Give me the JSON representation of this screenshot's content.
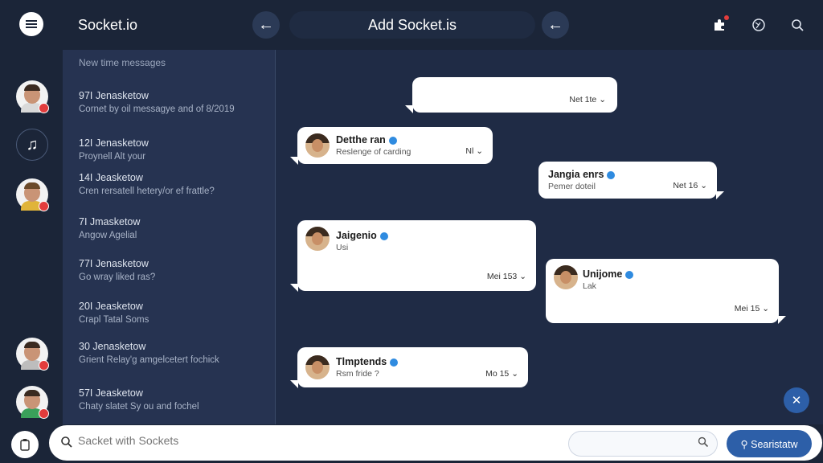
{
  "app": {
    "title": "Socket.io"
  },
  "header": {
    "title": "Add Socket.is",
    "back_arrow_left": "←",
    "back_arrow_right": "←"
  },
  "list": {
    "header": "New time messages",
    "items": [
      {
        "name": "97I Jenasketow",
        "msg": "Cornet by oil messagye and of 8/2019"
      },
      {
        "name": "12I Jenasketow",
        "msg": "Proynell Alt your"
      },
      {
        "name": "14I Jeasketow",
        "msg": "Cren rersatell hetery/or ef frattle?"
      },
      {
        "name": "7I Jmasketow",
        "msg": "Angow Agelial"
      },
      {
        "name": "77I Jenasketow",
        "msg": "Go wray liked ras?"
      },
      {
        "name": "20I Jeasketow",
        "msg": "Crapl Tatal Soms"
      },
      {
        "name": "30 Jenasketow",
        "msg": "Grient Relay'g amgelcetert fochick"
      },
      {
        "name": "57I Jeasketow",
        "msg": "Chaty slatet Sy ou and fochel"
      }
    ]
  },
  "chat": {
    "bubbles": [
      {
        "name": "",
        "sub": "",
        "time": "Net 1te ⌄"
      },
      {
        "name": "Detthe ran",
        "sub": "Reslenge of carding",
        "time": "Nl ⌄"
      },
      {
        "name": "Jangia enrs",
        "sub": "Pemer doteil",
        "time": "Net 16 ⌄"
      },
      {
        "name": "Jaigenio",
        "sub": "Usi",
        "time": "Mei 153 ⌄"
      },
      {
        "name": "Unijome",
        "sub": "Lak",
        "time": "Mei 15 ⌄"
      },
      {
        "name": "Tlmptends",
        "sub": "Rsm fride ?",
        "time": "Mo 15 ⌄"
      }
    ]
  },
  "bottom": {
    "input_placeholder": "Sacket with Sockets",
    "mini_search_placeholder": "",
    "send_label": "⚲ Searistatw"
  },
  "colors": {
    "accent": "#2d5fa8",
    "badge": "#e23c3c",
    "bg": "#1e2a40"
  }
}
